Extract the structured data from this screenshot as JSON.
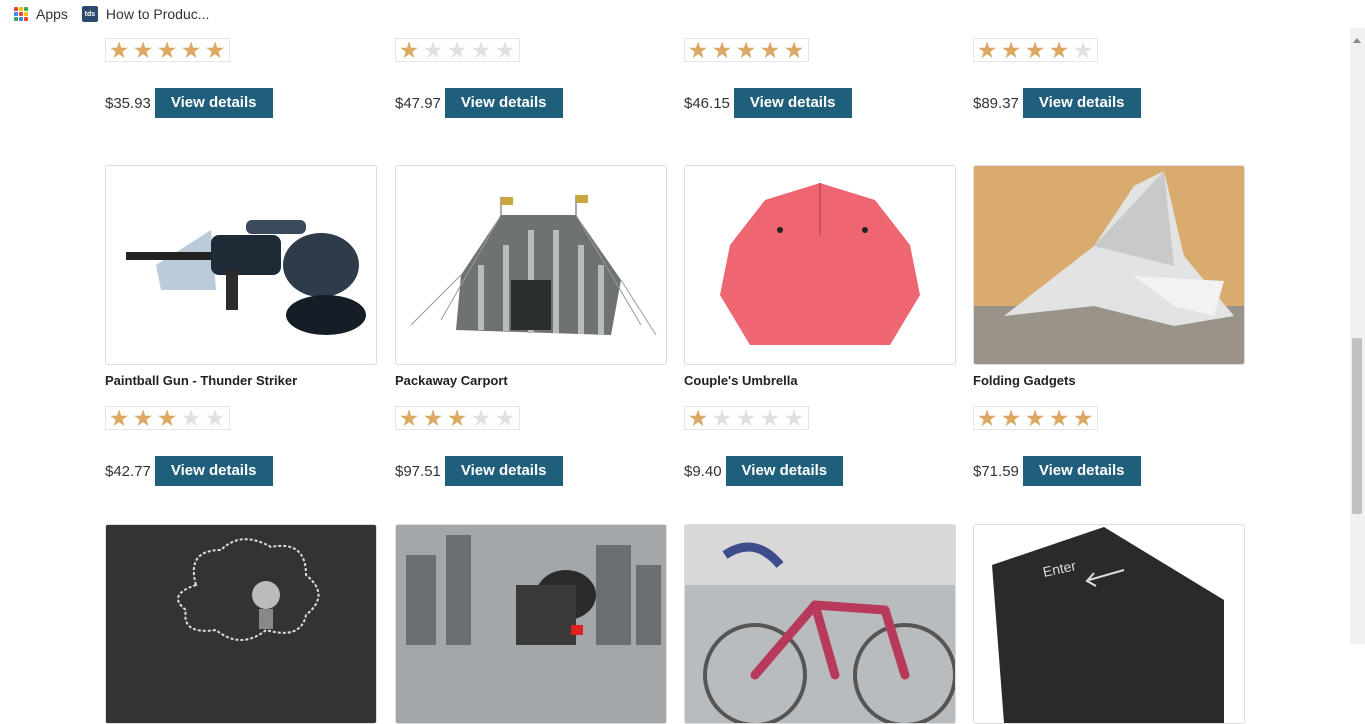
{
  "bookmarks": {
    "apps_label": "Apps",
    "page_label": "How to Produc..."
  },
  "colors": {
    "button": "#1f5f7c",
    "star_on": "#dca864",
    "star_off": "#e0e0e0"
  },
  "row1": [
    {
      "rating": 5,
      "price": "$35.93",
      "button": "View details"
    },
    {
      "rating": 1,
      "price": "$47.97",
      "button": "View details"
    },
    {
      "rating": 5,
      "price": "$46.15",
      "button": "View details"
    },
    {
      "rating": 4,
      "price": "$89.37",
      "button": "View details"
    }
  ],
  "row2": [
    {
      "title": "Paintball Gun - Thunder Striker",
      "image": "paintball-gun",
      "rating": 3,
      "price": "$42.77",
      "button": "View details"
    },
    {
      "title": "Packaway Carport",
      "image": "tent",
      "rating": 3,
      "price": "$97.51",
      "button": "View details"
    },
    {
      "title": "Couple's Umbrella",
      "image": "umbrella",
      "rating": 1,
      "price": "$9.40",
      "button": "View details"
    },
    {
      "title": "Folding Gadgets",
      "image": "paper-plane",
      "rating": 5,
      "price": "$71.59",
      "button": "View details"
    }
  ],
  "row3": [
    {
      "image": "lightbulb-chalkboard"
    },
    {
      "image": "city-skyline"
    },
    {
      "image": "knitted-bicycle"
    },
    {
      "image": "enter-key",
      "key_label": "Enter"
    }
  ]
}
